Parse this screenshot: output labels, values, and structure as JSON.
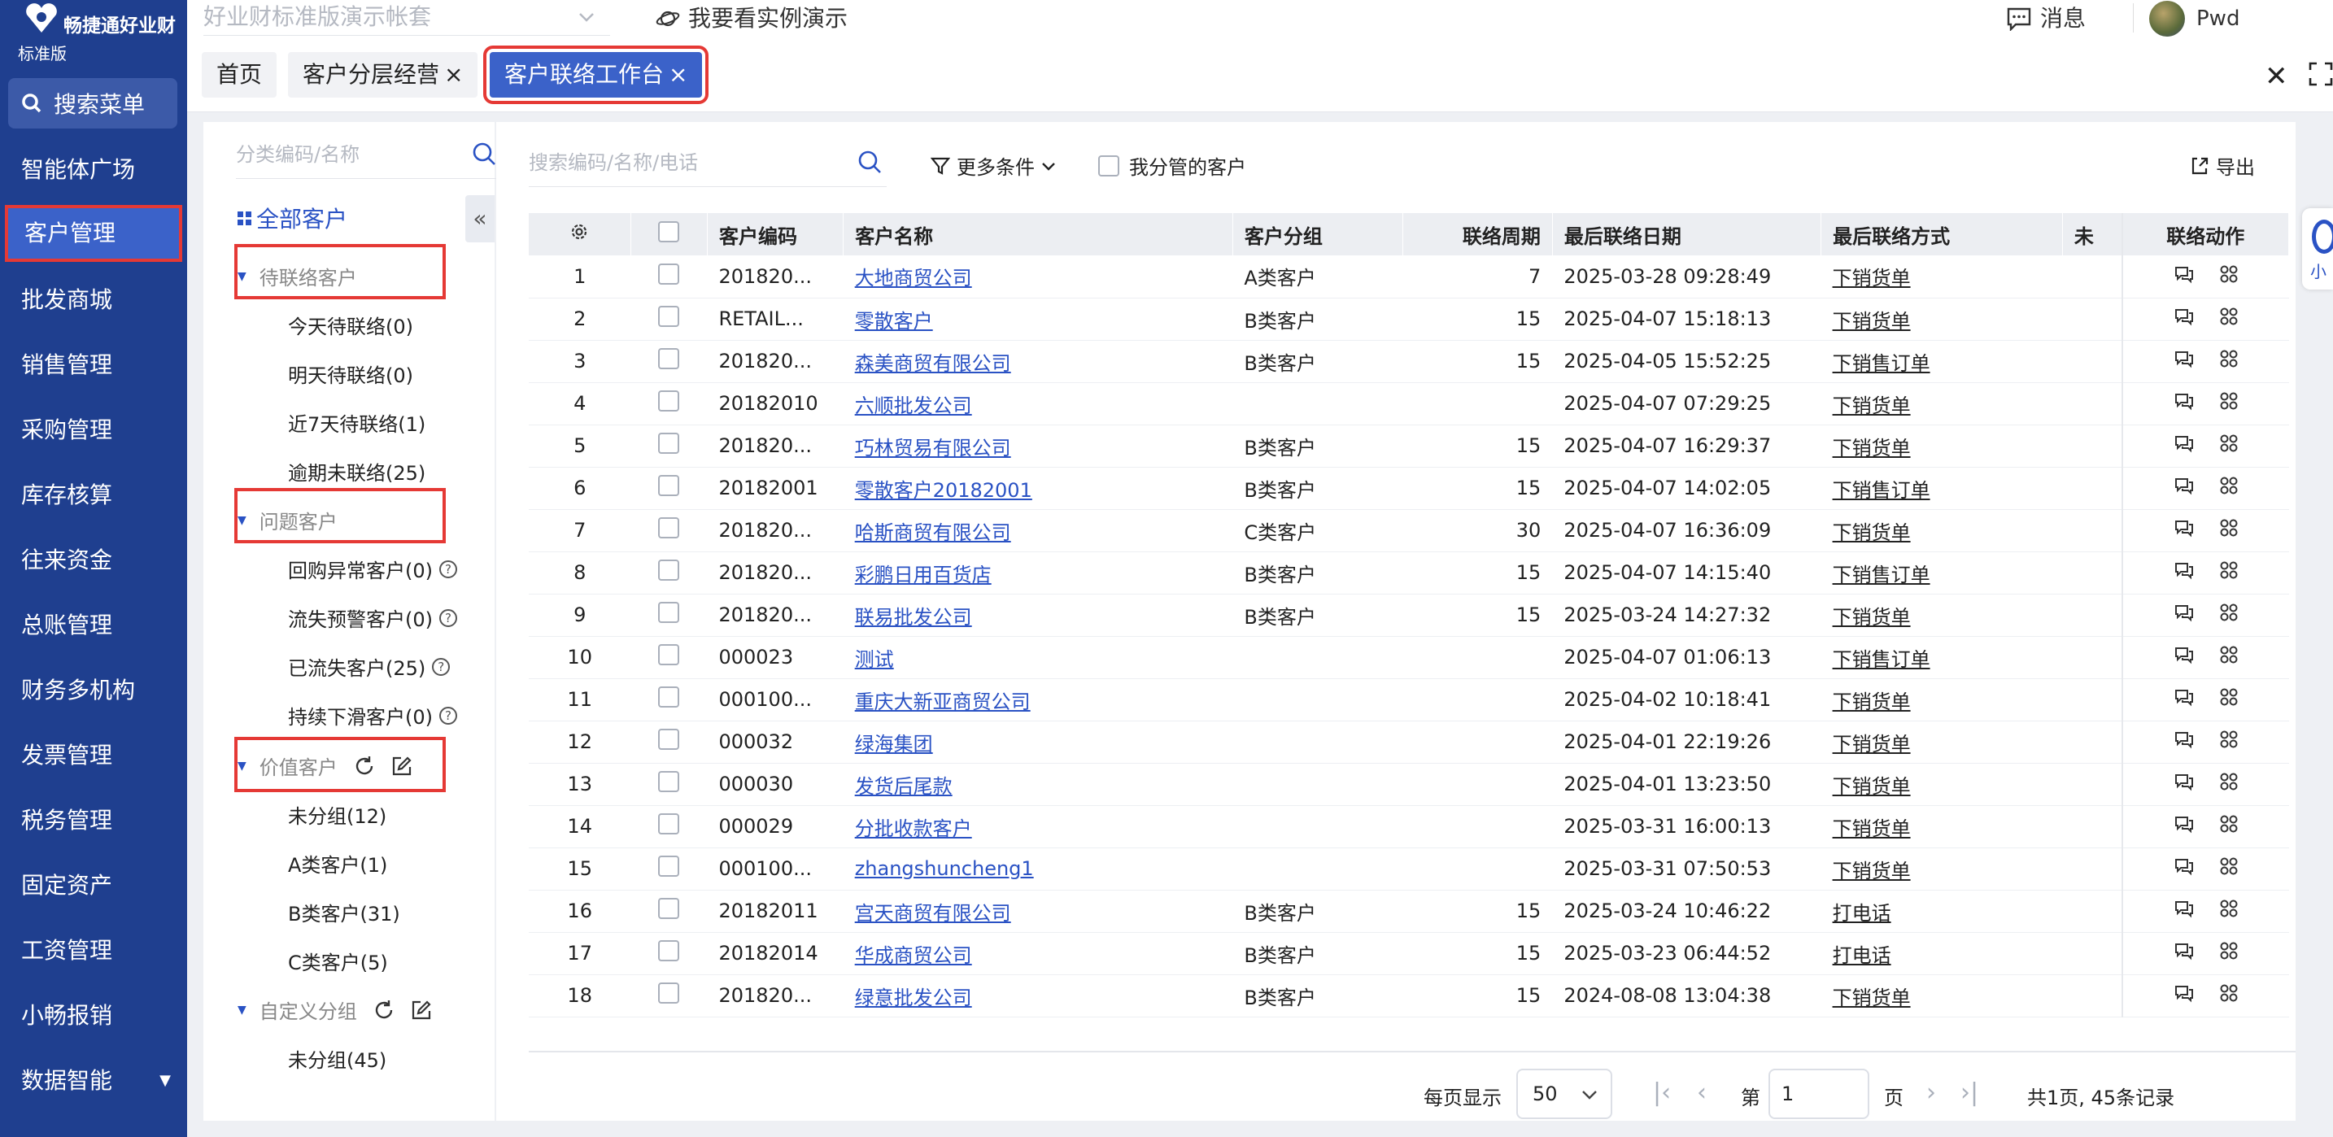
{
  "brand": {
    "name": "畅捷通好业财",
    "edition": "标准版"
  },
  "sidebar": {
    "search_label": "搜索菜单",
    "items": [
      {
        "label": "智能体广场"
      },
      {
        "label": "客户管理"
      },
      {
        "label": "批发商城"
      },
      {
        "label": "销售管理"
      },
      {
        "label": "采购管理"
      },
      {
        "label": "库存核算"
      },
      {
        "label": "往来资金"
      },
      {
        "label": "总账管理"
      },
      {
        "label": "财务多机构"
      },
      {
        "label": "发票管理"
      },
      {
        "label": "税务管理"
      },
      {
        "label": "固定资产"
      },
      {
        "label": "工资管理"
      },
      {
        "label": "小畅报销"
      },
      {
        "label": "数据智能"
      }
    ]
  },
  "topbar": {
    "account": "好业财标准版演示帐套",
    "demo": "我要看实例演示",
    "messages": "消息",
    "user": "Pwd"
  },
  "tabs": [
    {
      "label": "首页"
    },
    {
      "label": "客户分层经营"
    },
    {
      "label": "客户联络工作台"
    }
  ],
  "tree": {
    "search_placeholder": "分类编码/名称",
    "all": "全部客户",
    "groups": [
      {
        "title": "待联络客户",
        "items": [
          "今天待联络(0)",
          "明天待联络(0)",
          "近7天待联络(1)",
          "逾期未联络(25)"
        ]
      },
      {
        "title": "问题客户",
        "items": [
          "回购异常客户(0)",
          "流失预警客户(0)",
          "已流失客户(25)",
          "持续下滑客户(0)"
        ]
      },
      {
        "title": "价值客户",
        "items": [
          "未分组(12)",
          "A类客户(1)",
          "B类客户(31)",
          "C类客户(5)"
        ]
      },
      {
        "title": "自定义分组",
        "items": [
          "未分组(45)"
        ]
      }
    ]
  },
  "toolbar": {
    "search_placeholder": "搜索编码/名称/电话",
    "more": "更多条件",
    "mine": "我分管的客户",
    "export": "导出"
  },
  "table": {
    "headers": [
      "客户编码",
      "客户名称",
      "客户分组",
      "联络周期",
      "最后联络日期",
      "最后联络方式",
      "未",
      "联络动作"
    ],
    "rows": [
      [
        "1",
        "201820...",
        "大地商贸公司",
        "A类客户",
        "7",
        "2025-03-28 09:28:49",
        "下销货单"
      ],
      [
        "2",
        "RETAIL...",
        "零散客户",
        "B类客户",
        "15",
        "2025-04-07 15:18:13",
        "下销货单"
      ],
      [
        "3",
        "201820...",
        "森美商贸有限公司",
        "B类客户",
        "15",
        "2025-04-05 15:52:25",
        "下销售订单"
      ],
      [
        "4",
        "20182010",
        "六顺批发公司",
        "",
        "",
        "2025-04-07 07:29:25",
        "下销货单"
      ],
      [
        "5",
        "201820...",
        "巧林贸易有限公司",
        "B类客户",
        "15",
        "2025-04-07 16:29:37",
        "下销货单"
      ],
      [
        "6",
        "20182001",
        "零散客户20182001",
        "B类客户",
        "15",
        "2025-04-07 14:02:05",
        "下销售订单"
      ],
      [
        "7",
        "201820...",
        "哈斯商贸有限公司",
        "C类客户",
        "30",
        "2025-04-07 16:36:09",
        "下销货单"
      ],
      [
        "8",
        "201820...",
        "彩鹏日用百货店",
        "B类客户",
        "15",
        "2025-04-07 14:15:40",
        "下销售订单"
      ],
      [
        "9",
        "201820...",
        "联易批发公司",
        "B类客户",
        "15",
        "2025-03-24 14:27:32",
        "下销货单"
      ],
      [
        "10",
        "000023",
        "测试",
        "",
        "",
        "2025-04-07 01:06:13",
        "下销售订单"
      ],
      [
        "11",
        "000100...",
        "重庆大新亚商贸公司",
        "",
        "",
        "2025-04-02 10:18:41",
        "下销货单"
      ],
      [
        "12",
        "000032",
        "绿海集团",
        "",
        "",
        "2025-04-01 22:19:26",
        "下销货单"
      ],
      [
        "13",
        "000030",
        "发货后尾款",
        "",
        "",
        "2025-04-01 13:23:50",
        "下销货单"
      ],
      [
        "14",
        "000029",
        "分批收款客户",
        "",
        "",
        "2025-03-31 16:00:13",
        "下销货单"
      ],
      [
        "15",
        "000100...",
        "zhangshuncheng1",
        "",
        "",
        "2025-03-31 07:50:53",
        "下销货单"
      ],
      [
        "16",
        "20182011",
        "宫天商贸有限公司",
        "B类客户",
        "15",
        "2025-03-24 10:46:22",
        "打电话"
      ],
      [
        "17",
        "20182014",
        "华成商贸公司",
        "B类客户",
        "15",
        "2025-03-23 06:44:52",
        "打电话"
      ],
      [
        "18",
        "201820...",
        "绿意批发公司",
        "B类客户",
        "15",
        "2024-08-08 13:04:38",
        "下销货单"
      ]
    ]
  },
  "pager": {
    "per_page_label": "每页显示",
    "per_page": "50",
    "di": "第",
    "page": "1",
    "ye": "页",
    "total": "共1页, 45条记录"
  },
  "float_text": "小",
  "colors": {
    "sidebar": "#1f3f8f",
    "accent": "#3b62c9",
    "highlight": "#e53935",
    "link": "#2a52c4"
  }
}
